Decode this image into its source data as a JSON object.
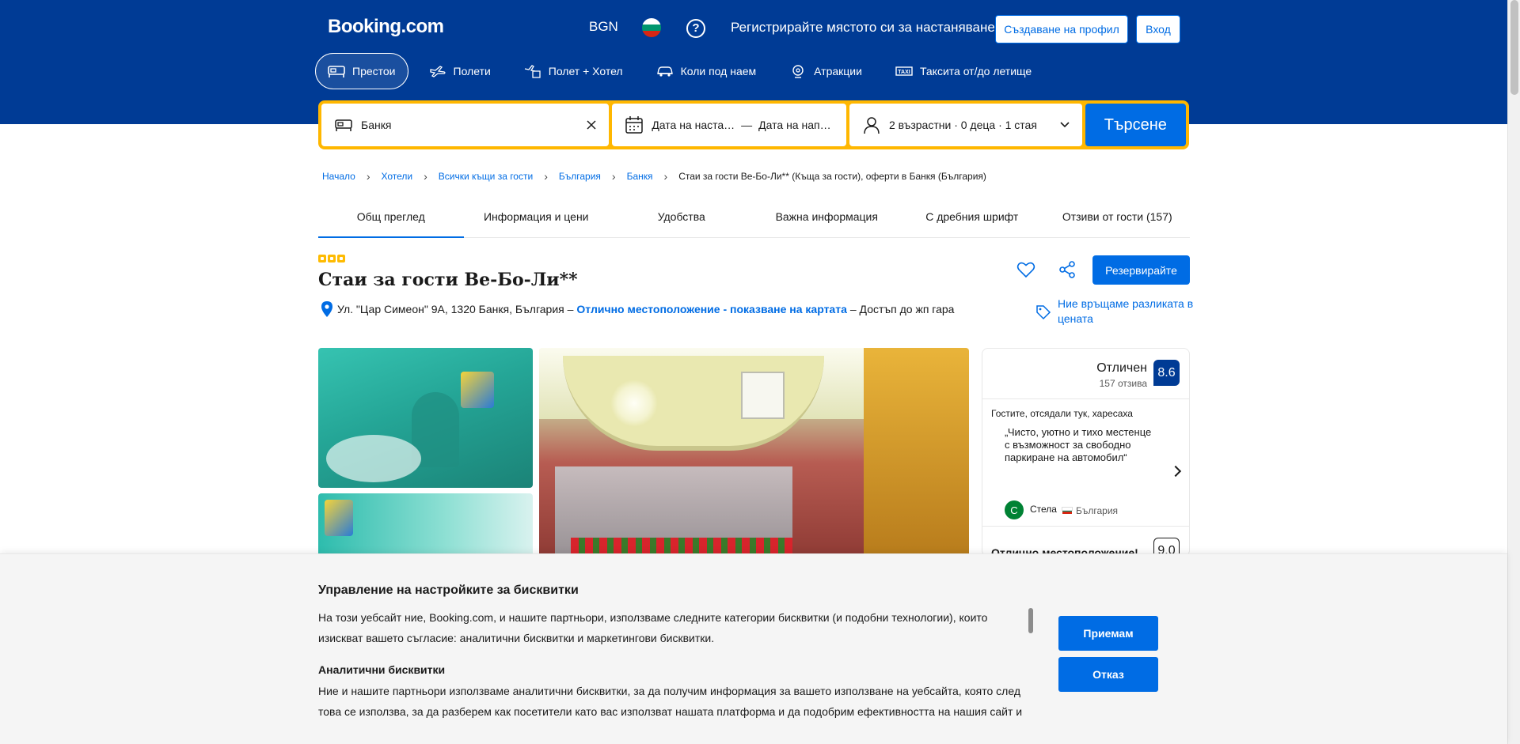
{
  "header": {
    "logo": "Booking.com",
    "currency": "BGN",
    "list_property": "Регистрирайте мястото си за настаняване",
    "register": "Създаване на профил",
    "signin": "Вход",
    "brand_color": "#003b95"
  },
  "nav": {
    "items": [
      {
        "label": "Престои",
        "icon": "bed-icon",
        "active": true
      },
      {
        "label": "Полети",
        "icon": "plane-icon"
      },
      {
        "label": "Полет + Хотел",
        "icon": "plane-hotel-icon"
      },
      {
        "label": "Коли под наем",
        "icon": "car-icon"
      },
      {
        "label": "Атракции",
        "icon": "attractions-icon"
      },
      {
        "label": "Таксита от/до летище",
        "icon": "taxi-icon"
      }
    ]
  },
  "search": {
    "destination": "Банкя",
    "checkin": "Дата на наста…",
    "dash": "—",
    "checkout": "Дата на нап…",
    "guests": "2 възрастни · 0 деца · 1 стая",
    "button": "Търсене"
  },
  "breadcrumb": {
    "items": [
      "Начало",
      "Хотели",
      "Всички къщи за гости",
      "България",
      "Банкя"
    ],
    "current": "Стаи за гости Ве-Бо-Ли** (Къща за гости), оферти в Банкя (България)"
  },
  "tabs": [
    "Общ преглед",
    "Информация и цени",
    "Удобства",
    "Важна информация",
    "С дребния шрифт",
    "Отзиви от гости (157)"
  ],
  "hotel": {
    "name": "Стаи за гости Ве-Бо-Ли**",
    "address_prefix": "Ул. \"Цар Симеон\" 9А, 1320 Банкя, България –",
    "location_link": "Отлично местоположение - показване на картата",
    "address_suffix": "– Достъп до жп гара",
    "reserve": "Резервирайте",
    "price_match": "Ние връщаме разликата в цената",
    "stars": 3
  },
  "review": {
    "word": "Отличен",
    "count": "157 отзива",
    "score": "8.6",
    "liked_title": "Гостите, отсядали тук, харесаха",
    "quote": "„Чисто, уютно и тихо местенце с възможност за свободно паркиране на автомобил“",
    "avatar_letter": "С",
    "reviewer": "Стела",
    "country": "България",
    "location_label": "Отлично местоположение!",
    "location_score": "9.0"
  },
  "cookie": {
    "title": "Управление на настройките за бисквитки",
    "body": "На този уебсайт ние, Booking.com, и нашите партньори, използваме следните категории бисквитки (и подобни технологии), които изискват вашето съгласие: аналитични бисквитки и маркетингови бисквитки.",
    "subtitle": "Аналитични бисквитки",
    "body2": "Ние и нашите партньори използваме аналитични бисквитки, за да получим информация за вашето използване на уебсайта, която след това се използва, за да разберем как посетители като вас използват нашата платформа и да подобрим ефективността на нашия сайт и",
    "accept": "Приемам",
    "reject": "Отказ"
  }
}
